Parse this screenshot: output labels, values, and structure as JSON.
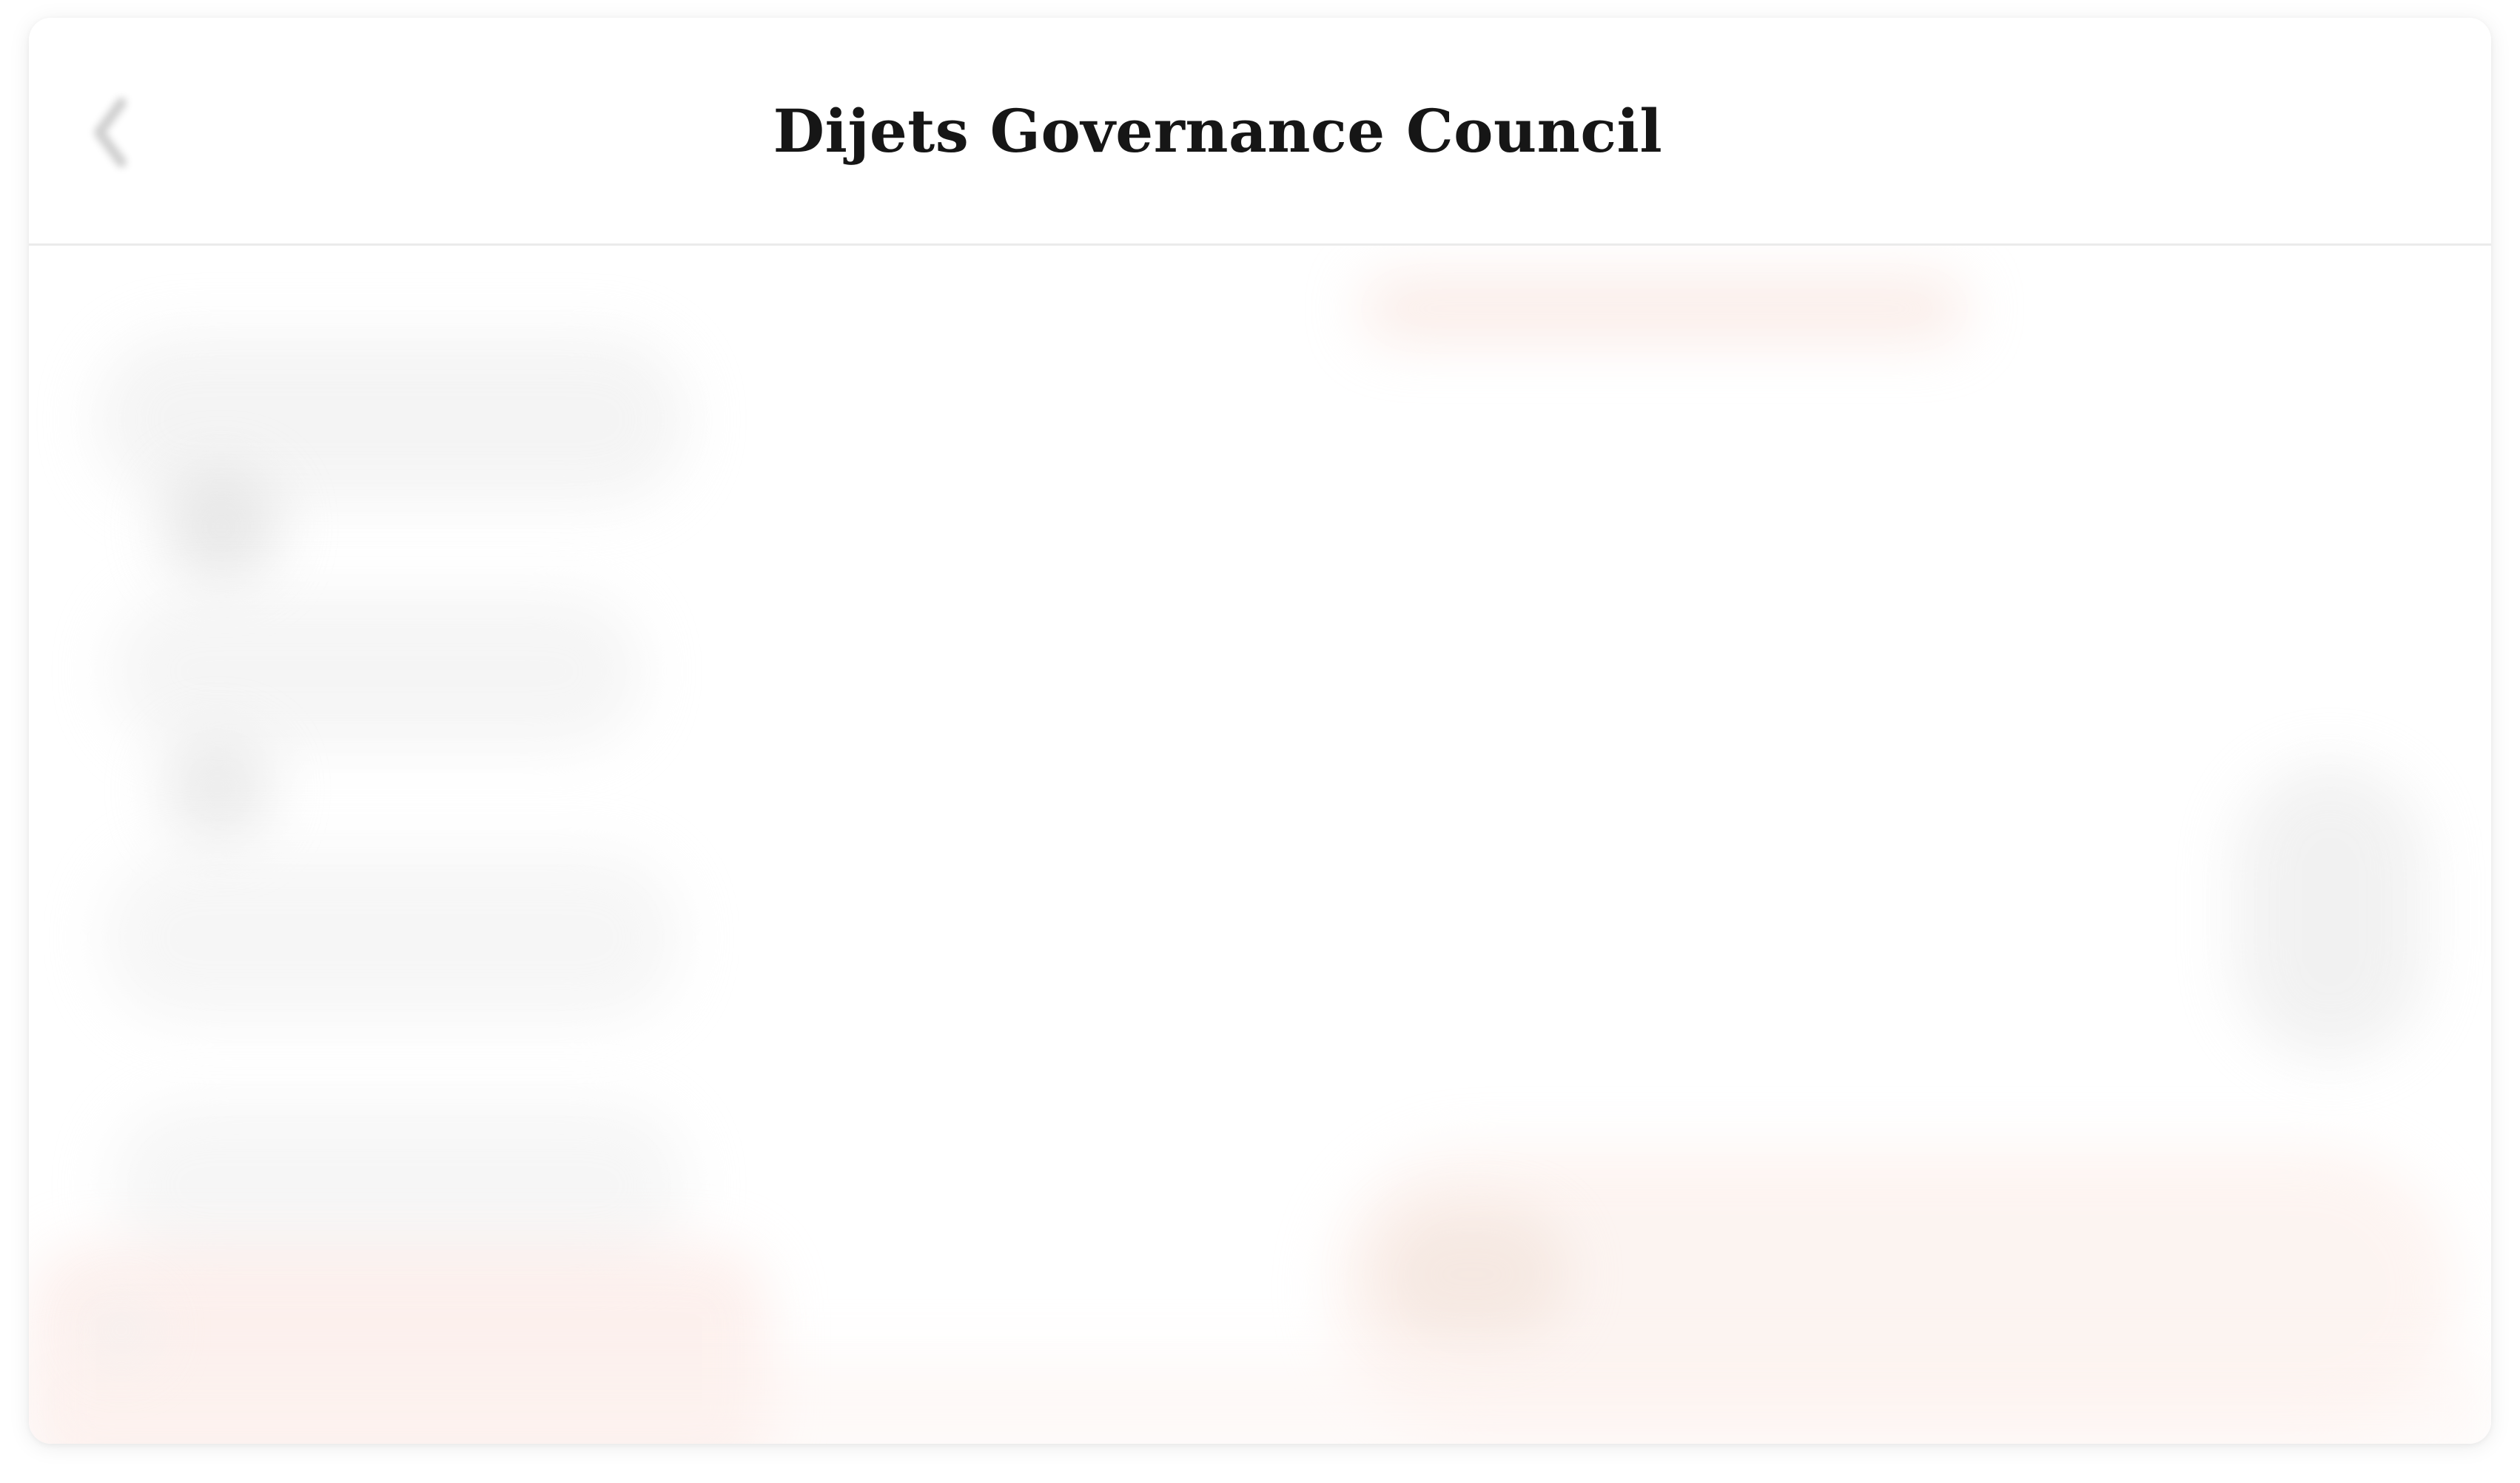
{
  "header": {
    "title": "Dijets Governance Council",
    "back_icon": "chevron-left-icon"
  },
  "colors": {
    "title_text": "#161616",
    "header_divider": "#ebebeb",
    "background": "#ffffff",
    "blurred_accent": "#fbe5e0"
  }
}
